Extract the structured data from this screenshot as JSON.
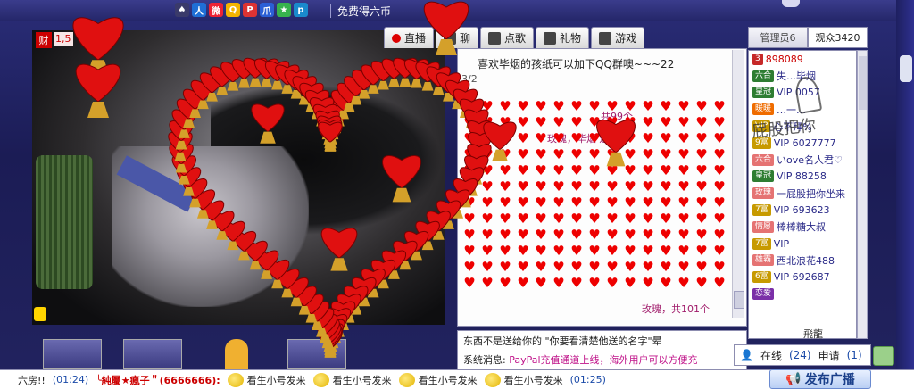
{
  "header": {
    "free_coin_label": "免费得六币",
    "icons": [
      "spade-icon",
      "person-icon",
      "weibo-icon",
      "qzone-icon",
      "badge-icon",
      "paw-icon",
      "star-icon",
      "p-icon"
    ]
  },
  "left": {
    "tag_char": "财",
    "tag_text": "1,5"
  },
  "tabs": [
    {
      "label": "直播",
      "icon": "red-dot-icon"
    },
    {
      "label": "聊",
      "icon": "chat-icon"
    },
    {
      "label": "点歌",
      "icon": "mic-icon"
    },
    {
      "label": "礼物",
      "icon": "gift-icon"
    },
    {
      "label": "游戏",
      "icon": "gamepad-icon"
    }
  ],
  "right_tabs": [
    {
      "label": "管理员6"
    },
    {
      "label": "观众3420"
    }
  ],
  "chat": {
    "line1": "喜欢毕烟的孩纸可以加下QQ群噢~~~22",
    "line2": "3/2",
    "line3": "共99个",
    "line4": "玫瑰，毕烟 送",
    "line5": "玫瑰，共101个"
  },
  "messages": {
    "msg1": "东西不是送给你的 \"你要看清楚他送的名字\"晕",
    "msg2_prefix": "系统消息: ",
    "msg2_paypal": "PayPal充值通道上线，海外用户可以方便充"
  },
  "users": [
    {
      "badge": "3",
      "badge_color": "b-red",
      "name": "898089",
      "name_class": "red"
    },
    {
      "badge": "六合",
      "badge_color": "b-green",
      "name": "失…毕烟",
      "name_class": ""
    },
    {
      "badge": "皇冠",
      "badge_color": "b-green",
      "name": "VIP 0057",
      "name_class": ""
    },
    {
      "badge": "暖暖",
      "badge_color": "b-orange",
      "name": "…一…",
      "name_class": ""
    },
    {
      "badge": "VIP",
      "badge_color": "b-gold",
      "name": "心不拜%",
      "name_class": ""
    },
    {
      "badge": "9富",
      "badge_color": "b-gold",
      "name": "VIP 6027777",
      "name_class": ""
    },
    {
      "badge": "六合",
      "badge_color": "b-pink",
      "name": "いove名人君♡",
      "name_class": ""
    },
    {
      "badge": "皇冠",
      "badge_color": "b-green",
      "name": "VIP 88258",
      "name_class": ""
    },
    {
      "badge": "玫瑰",
      "badge_color": "b-pink",
      "name": "一屁股把你坐来",
      "name_class": ""
    },
    {
      "badge": "7富",
      "badge_color": "b-gold",
      "name": "VIP 693623",
      "name_class": ""
    },
    {
      "badge": "情愿",
      "badge_color": "b-pink",
      "name": "棒棒糖大叔",
      "name_class": ""
    },
    {
      "badge": "7富",
      "badge_color": "b-gold",
      "name": "VIP",
      "name_class": ""
    },
    {
      "badge": "雄霸",
      "badge_color": "b-pink",
      "name": "西北浪花488",
      "name_class": ""
    },
    {
      "badge": "6富",
      "badge_color": "b-gold",
      "name": "VIP 692687",
      "name_class": ""
    },
    {
      "badge": "恋爱",
      "badge_color": "b-purple",
      "name": "",
      "name_class": ""
    }
  ],
  "online": {
    "label": "在线",
    "count": "(24)",
    "apply_label": "申请",
    "apply_count": "(1)"
  },
  "bottom": {
    "left_text": "六房!!",
    "time1": "(01:24)",
    "user": "╰純屬★瘋子＂(6666666):",
    "msg": "看生小号发来",
    "time2": "(01:25)",
    "broadcast_label": "发布广播"
  },
  "signature_text": "屁股把你",
  "flying_label": "飛龍"
}
